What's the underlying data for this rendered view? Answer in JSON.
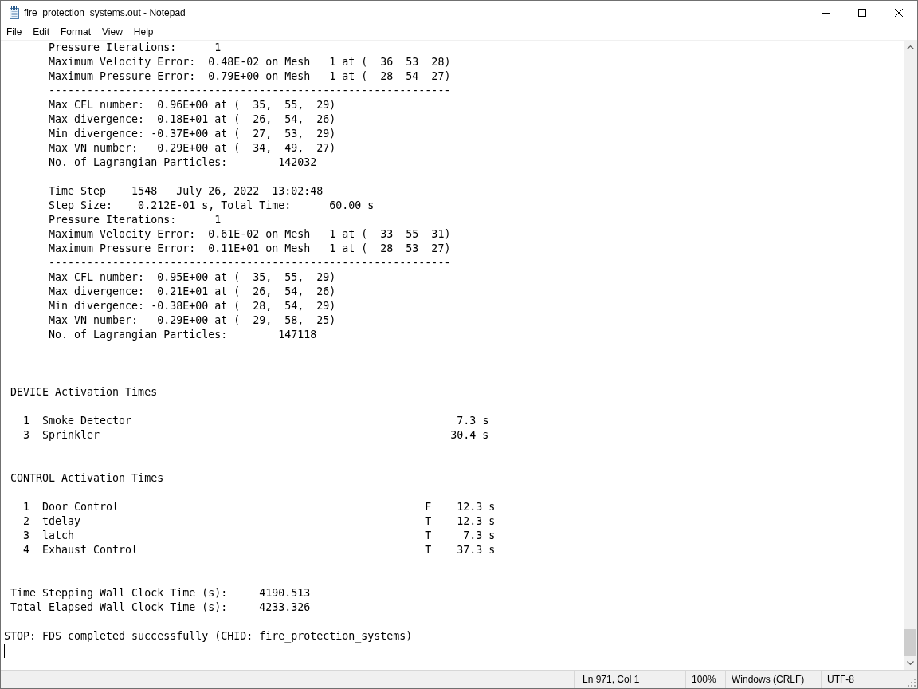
{
  "window": {
    "title": "fire_protection_systems.out - Notepad"
  },
  "menu": [
    "File",
    "Edit",
    "Format",
    "View",
    "Help"
  ],
  "document": {
    "lines": [
      {
        "kind": "text",
        "text": "       Pressure Iterations:      1"
      },
      {
        "kind": "text",
        "text": "       Maximum Velocity Error:  0.48E-02 on Mesh   1 at (  36  53  28)"
      },
      {
        "kind": "text",
        "text": "       Maximum Pressure Error:  0.79E+00 on Mesh   1 at (  28  54  27)"
      },
      {
        "kind": "text",
        "text": "       ---------------------------------------------------------------"
      },
      {
        "kind": "text",
        "text": "       Max CFL number:  0.96E+00 at (  35,  55,  29)"
      },
      {
        "kind": "text",
        "text": "       Max divergence:  0.18E+01 at (  26,  54,  26)"
      },
      {
        "kind": "text",
        "text": "       Min divergence: -0.37E+00 at (  27,  53,  29)"
      },
      {
        "kind": "text",
        "text": "       Max VN number:   0.29E+00 at (  34,  49,  27)"
      },
      {
        "kind": "text",
        "text": "       No. of Lagrangian Particles:        142032"
      },
      {
        "kind": "blank"
      },
      {
        "kind": "text",
        "text": "       Time Step    1548   July 26, 2022  13:02:48"
      },
      {
        "kind": "text",
        "text": "       Step Size:    0.212E-01 s, Total Time:      60.00 s"
      },
      {
        "kind": "text",
        "text": "       Pressure Iterations:      1"
      },
      {
        "kind": "text",
        "text": "       Maximum Velocity Error:  0.61E-02 on Mesh   1 at (  33  55  31)"
      },
      {
        "kind": "text",
        "text": "       Maximum Pressure Error:  0.11E+01 on Mesh   1 at (  28  53  27)"
      },
      {
        "kind": "text",
        "text": "       ---------------------------------------------------------------"
      },
      {
        "kind": "text",
        "text": "       Max CFL number:  0.95E+00 at (  35,  55,  29)"
      },
      {
        "kind": "text",
        "text": "       Max divergence:  0.21E+01 at (  26,  54,  26)"
      },
      {
        "kind": "text",
        "text": "       Min divergence: -0.38E+00 at (  28,  54,  29)"
      },
      {
        "kind": "text",
        "text": "       Max VN number:   0.29E+00 at (  29,  58,  25)"
      },
      {
        "kind": "text",
        "text": "       No. of Lagrangian Particles:        147118"
      },
      {
        "kind": "blank"
      },
      {
        "kind": "blank"
      },
      {
        "kind": "blank"
      },
      {
        "kind": "text",
        "text": " DEVICE Activation Times"
      },
      {
        "kind": "blank"
      },
      {
        "kind": "device",
        "index": "1",
        "name": "Smoke Detector",
        "time": "7.3 s"
      },
      {
        "kind": "device",
        "index": "3",
        "name": "Sprinkler",
        "time": "30.4 s"
      },
      {
        "kind": "blank"
      },
      {
        "kind": "blank"
      },
      {
        "kind": "text",
        "text": " CONTROL Activation Times"
      },
      {
        "kind": "blank"
      },
      {
        "kind": "control",
        "index": "1",
        "name": "Door Control",
        "flag": "F",
        "time": "12.3 s"
      },
      {
        "kind": "control",
        "index": "2",
        "name": "tdelay",
        "flag": "T",
        "time": "12.3 s"
      },
      {
        "kind": "control",
        "index": "3",
        "name": "latch",
        "flag": "T",
        "time": "7.3 s"
      },
      {
        "kind": "control",
        "index": "4",
        "name": "Exhaust Control",
        "flag": "T",
        "time": "37.3 s"
      },
      {
        "kind": "blank"
      },
      {
        "kind": "blank"
      },
      {
        "kind": "text",
        "text": " Time Stepping Wall Clock Time (s):     4190.513"
      },
      {
        "kind": "text",
        "text": " Total Elapsed Wall Clock Time (s):     4233.326"
      },
      {
        "kind": "blank"
      },
      {
        "kind": "text",
        "text": "STOP: FDS completed successfully (CHID: fire_protection_systems)"
      },
      {
        "kind": "cursor"
      }
    ]
  },
  "status_bar": {
    "position": "Ln 971, Col 1",
    "zoom": "100%",
    "line_ending": "Windows (CRLF)",
    "encoding": "UTF-8"
  }
}
